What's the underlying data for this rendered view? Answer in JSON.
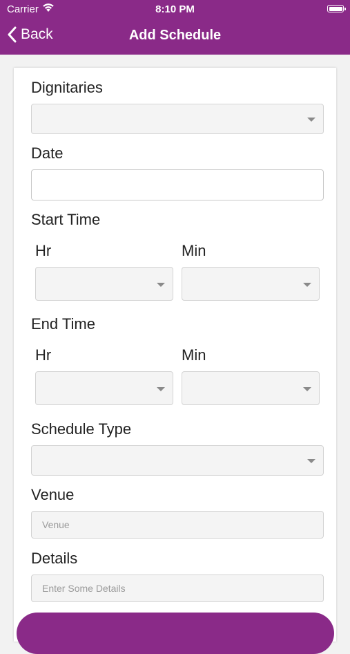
{
  "status_bar": {
    "carrier": "Carrier",
    "time": "8:10 PM"
  },
  "nav": {
    "back_label": "Back",
    "title": "Add Schedule"
  },
  "form": {
    "dignitaries_label": "Dignitaries",
    "date_label": "Date",
    "start_time_label": "Start Time",
    "end_time_label": "End Time",
    "hr_label": "Hr",
    "min_label": "Min",
    "schedule_type_label": "Schedule Type",
    "venue_label": "Venue",
    "venue_placeholder": "Venue",
    "details_label": "Details",
    "details_placeholder": "Enter Some Details"
  },
  "colors": {
    "brand": "#8a2a88"
  },
  "icons": {
    "back": "chevron-left-icon",
    "wifi": "wifi-icon",
    "battery": "battery-icon",
    "dropdown": "caret-down-icon"
  }
}
